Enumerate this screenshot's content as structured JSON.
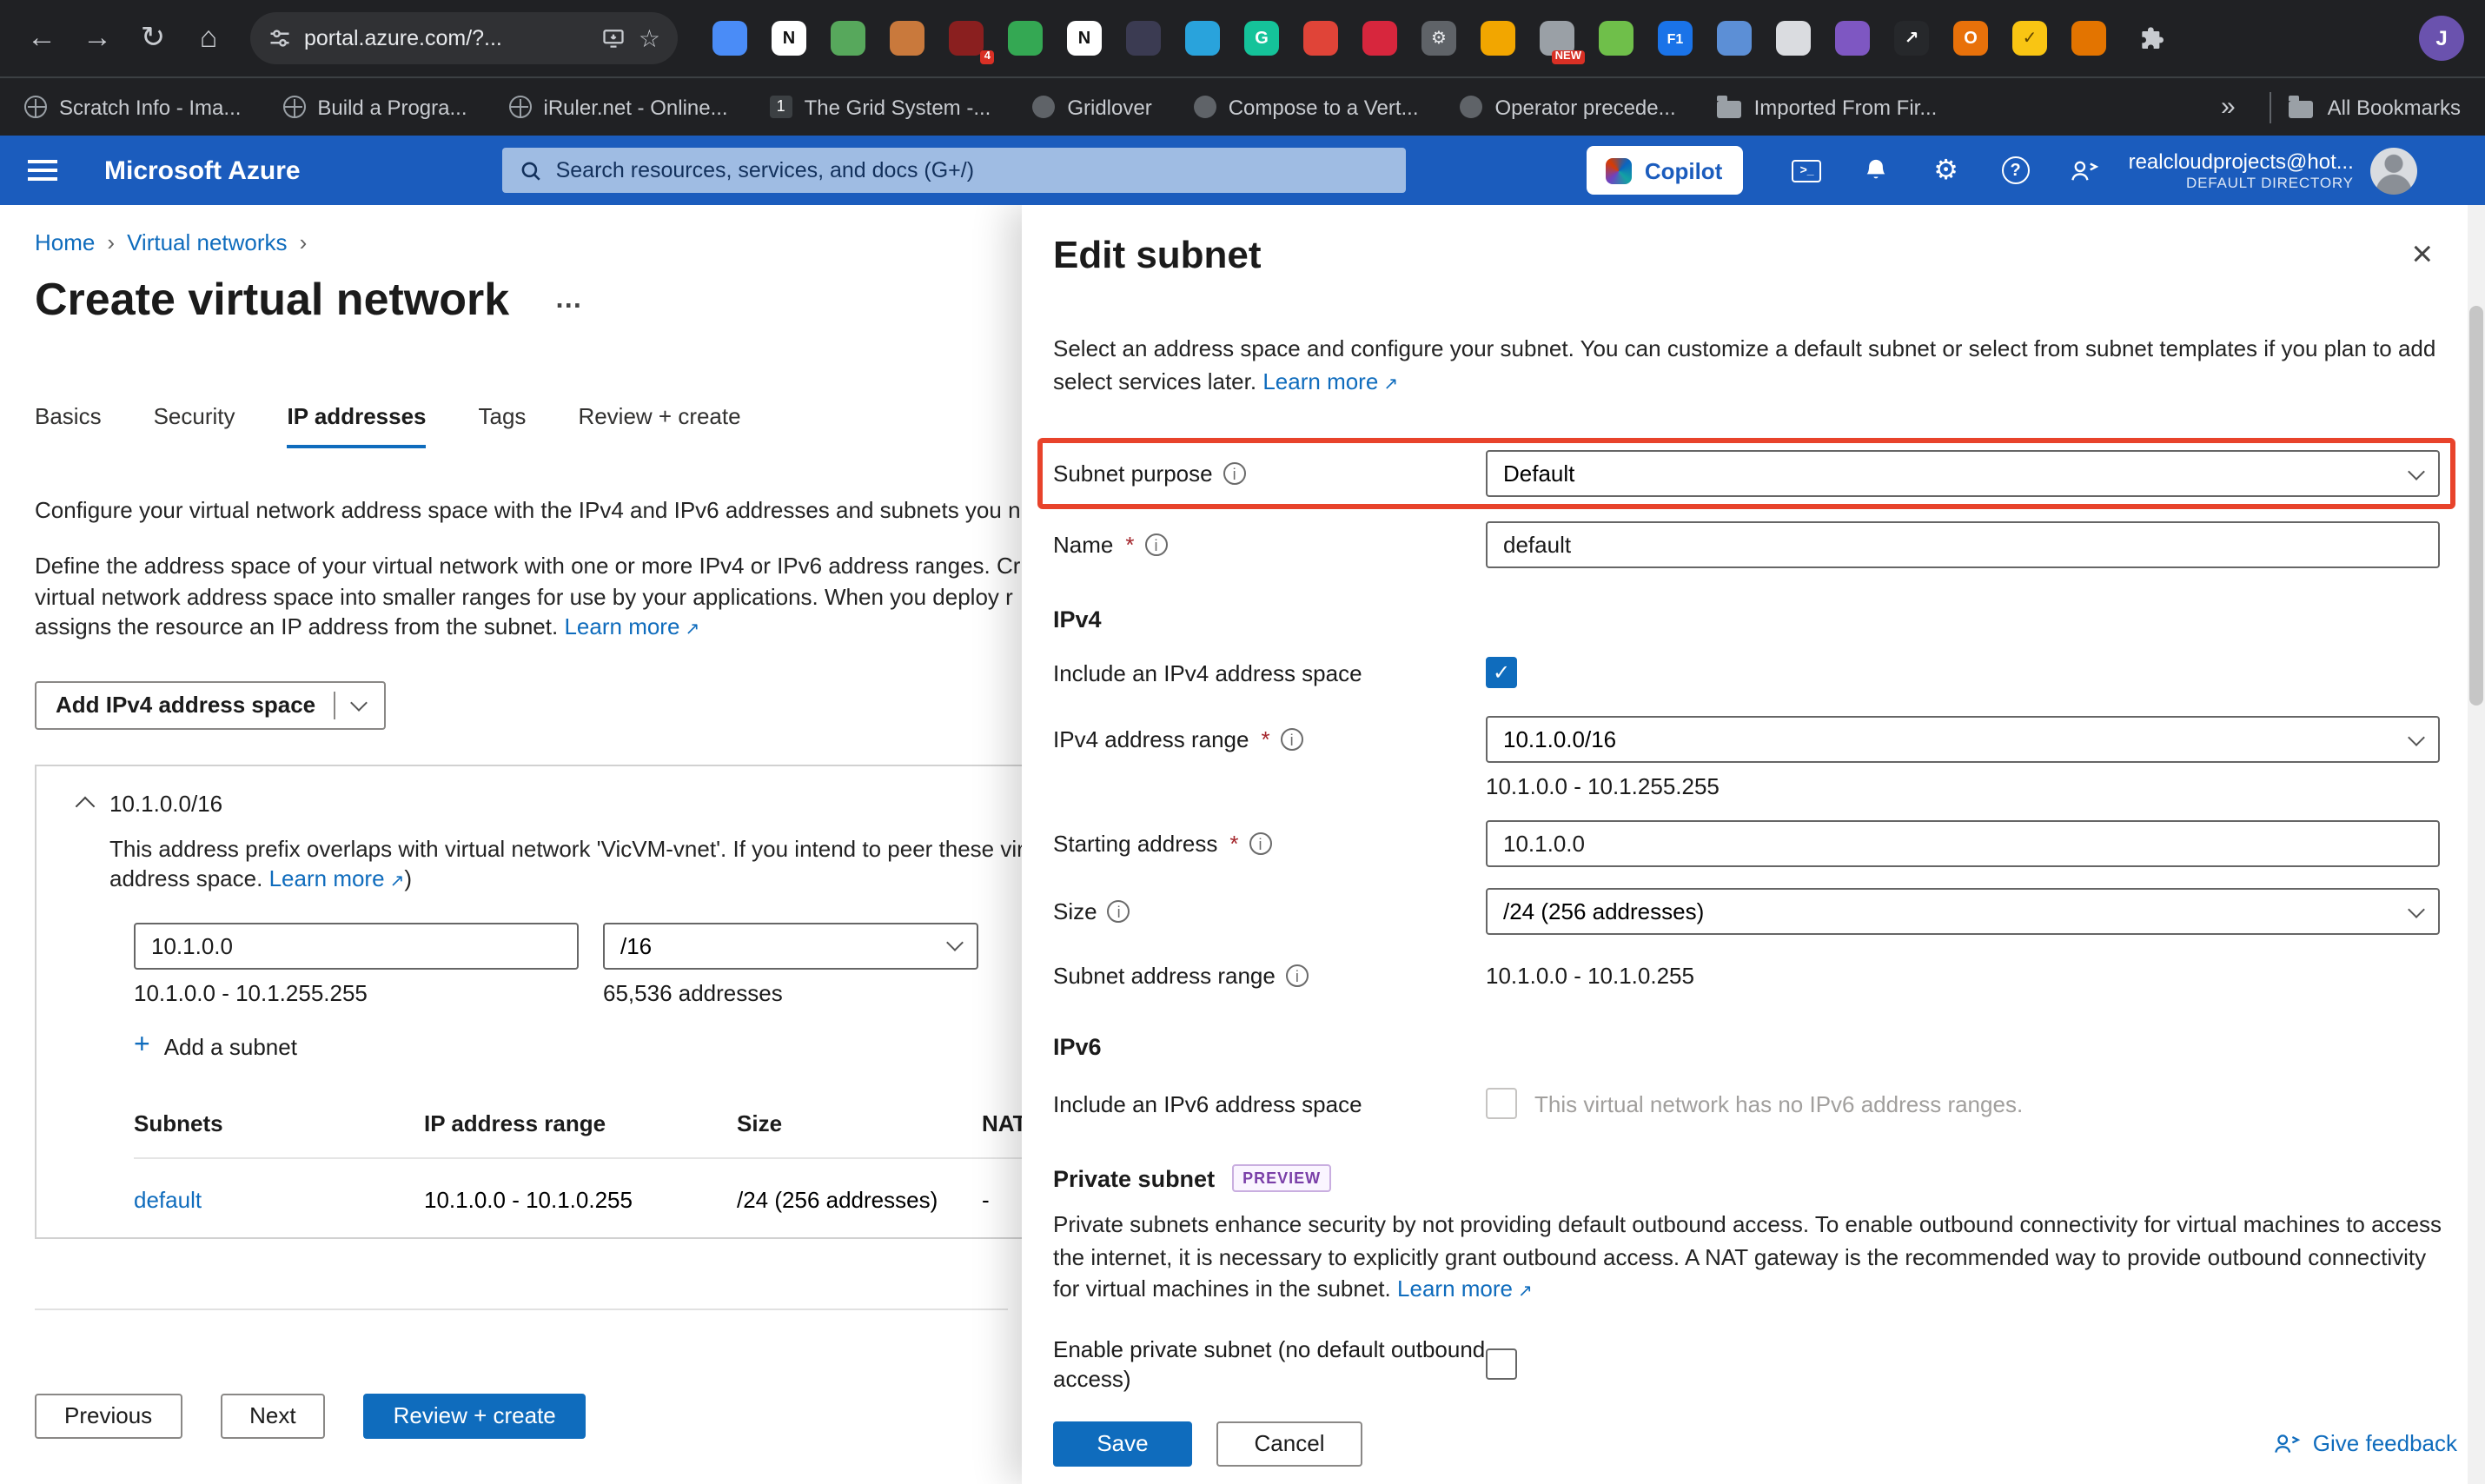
{
  "colors": {
    "accent": "#0f6cbd",
    "azure_header_blue": "#1b5cbd",
    "highlight_red": "#e8432b",
    "preview_purple": "#7a3fa8"
  },
  "icons": {
    "info": "i",
    "required": "*",
    "external_link": "↗",
    "back": "←",
    "forward": "→",
    "reload": "↻",
    "home": "⌂",
    "star": "☆",
    "close": "×",
    "help": "?",
    "cloud_shell": ">_",
    "gear": "⚙",
    "plus": "+"
  },
  "browser": {
    "url": "portal.azure.com/?...",
    "profile_initial": "J",
    "bookmarks_overflow": "»",
    "all_bookmarks_label": "All Bookmarks",
    "bookmarks": [
      {
        "label": "Scratch Info - Ima...",
        "icon": "globe"
      },
      {
        "label": "Build a Progra...",
        "icon": "globe"
      },
      {
        "label": "iRuler.net - Online...",
        "icon": "globe"
      },
      {
        "label": "The Grid System -...",
        "icon": "one",
        "glyph": "1"
      },
      {
        "label": "Gridlover",
        "icon": "dot"
      },
      {
        "label": "Compose to a Vert...",
        "icon": "dot"
      },
      {
        "label": "Operator precede...",
        "icon": "dot"
      },
      {
        "label": "Imported From Fir...",
        "icon": "folder"
      }
    ],
    "extensions": [
      {
        "bg": "#4a8cf7",
        "glyph": ""
      },
      {
        "bg": "#ffffff",
        "glyph": "N",
        "fg": "#111111"
      },
      {
        "bg": "#57a85c",
        "glyph": ""
      },
      {
        "bg": "#c9793c",
        "glyph": ""
      },
      {
        "bg": "#8a1f1f",
        "glyph": "",
        "badge": "4"
      },
      {
        "bg": "#34a853",
        "glyph": ""
      },
      {
        "bg": "#ffffff",
        "glyph": "N",
        "fg": "#111111"
      },
      {
        "bg": "#3b3b52",
        "glyph": ""
      },
      {
        "bg": "#29a3dc",
        "glyph": ""
      },
      {
        "bg": "#15c39a",
        "glyph": "G",
        "fg": "#ffffff"
      },
      {
        "bg": "#e04438",
        "glyph": ""
      },
      {
        "bg": "#d7263d",
        "glyph": ""
      },
      {
        "bg": "#5f6368",
        "glyph": "⚙",
        "fg": "#e8eaed"
      },
      {
        "bg": "#f2a600",
        "glyph": ""
      },
      {
        "bg": "#9aa0a6",
        "glyph": "",
        "badge": "NEW"
      },
      {
        "bg": "#6fbf4a",
        "glyph": ""
      },
      {
        "bg": "#1a73e8",
        "glyph": "F1",
        "fg": "#ffffff"
      },
      {
        "bg": "#5c8fd6",
        "glyph": ""
      },
      {
        "bg": "#dadce0",
        "glyph": ""
      },
      {
        "bg": "#7e57c2",
        "glyph": ""
      },
      {
        "bg": "#26282b",
        "glyph": "↗",
        "fg": "#ffffff"
      },
      {
        "bg": "#e8710a",
        "glyph": "O",
        "fg": "#ffffff"
      },
      {
        "bg": "#f9c513",
        "glyph": "✓",
        "fg": "#5f4300"
      },
      {
        "bg": "#e37400",
        "glyph": ""
      }
    ]
  },
  "azure_header": {
    "brand": "Microsoft Azure",
    "search_placeholder": "Search resources, services, and docs (G+/)",
    "copilot_label": "Copilot",
    "account_email": "realcloudprojects@hot...",
    "account_directory": "DEFAULT DIRECTORY"
  },
  "breadcrumb": {
    "home": "Home",
    "virtual_networks": "Virtual networks"
  },
  "page": {
    "title": "Create virtual network",
    "kebab": "…",
    "tabs": [
      "Basics",
      "Security",
      "IP addresses",
      "Tags",
      "Review + create"
    ],
    "active_tab": "IP addresses",
    "intro": "Configure your virtual network address space with the IPv4 and IPv6 addresses and subnets you n",
    "description_lines": [
      "Define the address space of your virtual network with one or more IPv4 or IPv6 address ranges. Cr",
      "virtual network address space into smaller ranges for use by your applications. When you deploy r",
      "assigns the resource an IP address from the subnet."
    ],
    "learn_more": "Learn more",
    "add_ipv4_button": "Add IPv4 address space",
    "address_space": {
      "cidr": "10.1.0.0/16",
      "warning_line1": "This address prefix overlaps with virtual network 'VicVM-vnet'. If you intend to peer these vir",
      "warning_line2": "address space.",
      "warning_learn_more": "Learn more",
      "warning_suffix": ")",
      "address_value": "10.1.0.0",
      "mask_value": "/16",
      "range": "10.1.0.0 - 10.1.255.255",
      "count": "65,536 addresses",
      "add_subnet_label": "Add a subnet"
    },
    "subnet_table": {
      "headers": [
        "Subnets",
        "IP address range",
        "Size",
        "NAT"
      ],
      "rows": [
        {
          "name": "default",
          "range": "10.1.0.0 - 10.1.0.255",
          "size": "/24 (256 addresses)",
          "nat": "-"
        }
      ]
    },
    "footer": {
      "previous": "Previous",
      "next": "Next",
      "review_create": "Review + create"
    }
  },
  "panel": {
    "title": "Edit subnet",
    "description": "Select an address space and configure your subnet. You can customize a default subnet or select from subnet templates if you plan to add select services later.",
    "learn_more": "Learn more",
    "subnet_purpose": {
      "label": "Subnet purpose",
      "value": "Default"
    },
    "name": {
      "label": "Name",
      "value": "default"
    },
    "ipv4": {
      "heading": "IPv4",
      "include_label": "Include an IPv4 address space",
      "include_checked": true,
      "range_label": "IPv4 address range",
      "range_value": "10.1.0.0/16",
      "range_sub": "10.1.0.0 - 10.1.255.255",
      "starting_label": "Starting address",
      "starting_value": "10.1.0.0",
      "size_label": "Size",
      "size_value": "/24 (256 addresses)",
      "subnet_range_label": "Subnet address range",
      "subnet_range_value": "10.1.0.0 - 10.1.0.255"
    },
    "ipv6": {
      "heading": "IPv6",
      "include_label": "Include an IPv6 address space",
      "disabled_note": "This virtual network has no IPv6 address ranges."
    },
    "private_subnet": {
      "heading": "Private subnet",
      "preview_badge": "PREVIEW",
      "description": "Private subnets enhance security by not providing default outbound access. To enable outbound connectivity for virtual machines to access the internet, it is necessary to explicitly grant outbound access. A NAT gateway is the recommended way to provide outbound connectivity for virtual machines in the subnet.",
      "learn_more": "Learn more",
      "enable_label": "Enable private subnet (no default outbound access)"
    },
    "buttons": {
      "save": "Save",
      "cancel": "Cancel",
      "give_feedback": "Give feedback"
    }
  }
}
